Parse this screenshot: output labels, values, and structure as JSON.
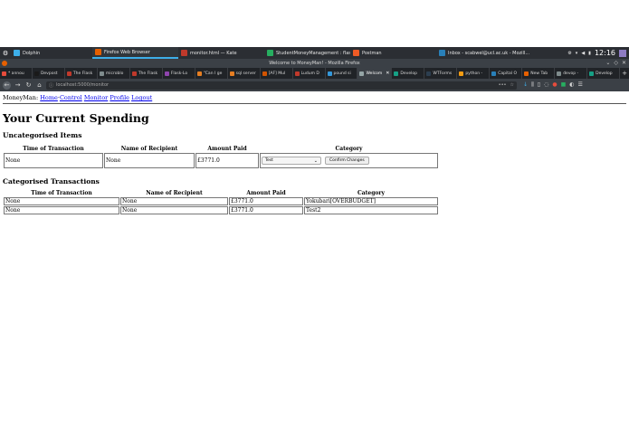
{
  "taskbar": {
    "tasks": [
      {
        "label": "Dolphin",
        "color": "#3daee9"
      },
      {
        "label": "Firefox Web Browser",
        "color": "#e66000"
      },
      {
        "label": "monitor.html — Kate",
        "color": "#c0392b"
      },
      {
        "label": "StudentMoneyManagement : flask...",
        "color": "#27ae60"
      },
      {
        "label": "Postman",
        "color": "#ef5b25"
      },
      {
        "label": "Inbox - scabwel@ucl.ac.uk - Mozill...",
        "color": "#2980b9"
      }
    ],
    "clock": "12:16"
  },
  "window": {
    "title": "Welcome to MoneyMan! - Mozilla Firefox"
  },
  "tabs": [
    {
      "label": "* annou",
      "color": "#e74c3c"
    },
    {
      "label": "Devpost",
      "color": "#1a1a1a"
    },
    {
      "label": "The Flask",
      "color": "#c0392b"
    },
    {
      "label": "microblo",
      "color": "#7f8c8d"
    },
    {
      "label": "The Flask",
      "color": "#c0392b"
    },
    {
      "label": "Flask-Lo",
      "color": "#8e44ad"
    },
    {
      "label": "\"Can I ge",
      "color": "#e67e22"
    },
    {
      "label": "sql server",
      "color": "#e67e22"
    },
    {
      "label": "[AF] Mul",
      "color": "#d35400"
    },
    {
      "label": "Ludum D",
      "color": "#c0392b"
    },
    {
      "label": "pound si",
      "color": "#3498db"
    },
    {
      "label": "Welcom",
      "color": "#95a5a6",
      "selected": true
    },
    {
      "label": "Develop",
      "color": "#16a085"
    },
    {
      "label": "WTForms",
      "color": "#2c3e50"
    },
    {
      "label": "python -",
      "color": "#f39c12"
    },
    {
      "label": "Capital O",
      "color": "#2980b9"
    },
    {
      "label": "New Tab",
      "color": "#e66000"
    },
    {
      "label": "devop -",
      "color": "#7f8c8d"
    },
    {
      "label": "Develop",
      "color": "#16a085"
    }
  ],
  "url": "localhost:5000/monitor",
  "nav": {
    "brand": "MoneyMan:",
    "links": [
      "Home",
      "Control",
      "Monitor",
      "Profile",
      "Logout"
    ]
  },
  "page": {
    "title": "Your Current Spending",
    "uncategorised": {
      "heading": "Uncategorised Items",
      "headers": [
        "Time of Transaction",
        "Name of Recipient",
        "Amount Paid",
        "Category"
      ],
      "rows": [
        {
          "time": "None",
          "recipient": "None",
          "amount": "£3771.0",
          "category": "Test",
          "action": "Confirm Changes"
        }
      ]
    },
    "categorised": {
      "heading": "Categorised Transactions",
      "headers": [
        "Time of Transaction",
        "Name of Recipient",
        "Amount Paid",
        "Category"
      ],
      "rows": [
        {
          "time": "None",
          "recipient": "None",
          "amount": "£3771.0",
          "category": "Yokubari[OVERBUDGET]"
        },
        {
          "time": "None",
          "recipient": "None",
          "amount": "£3771.0",
          "category": "Test2"
        }
      ]
    }
  }
}
